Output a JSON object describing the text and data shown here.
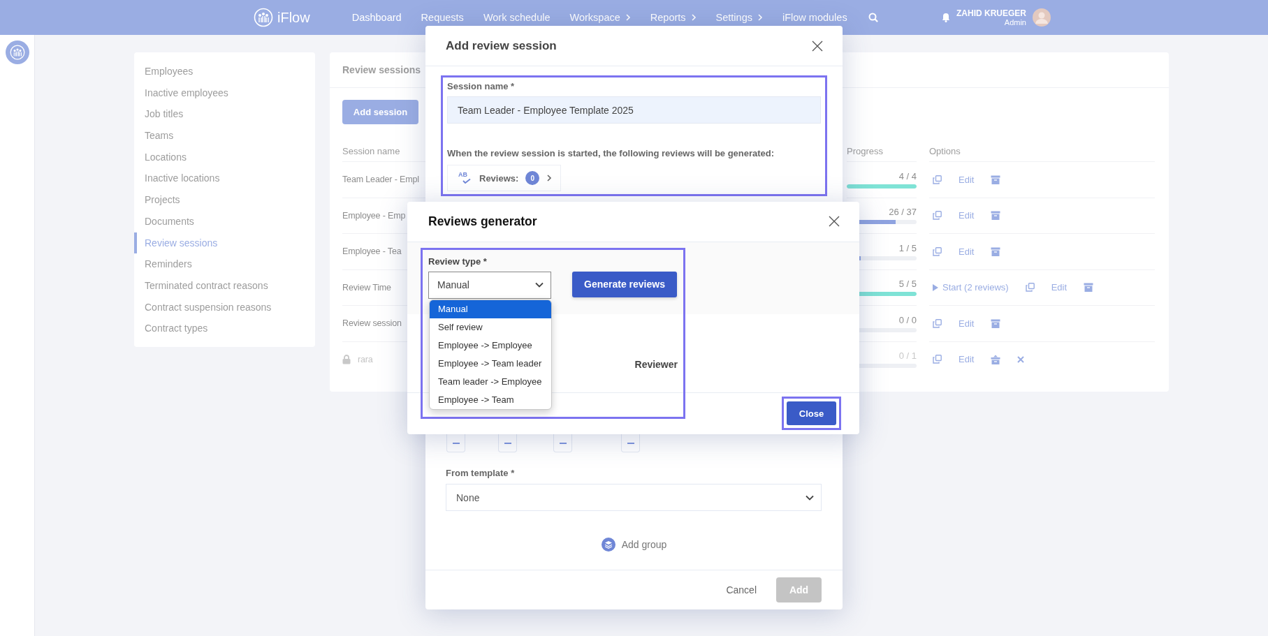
{
  "topbar": {
    "brand": "iFlow",
    "nav": [
      {
        "label": "Dashboard",
        "has_menu": false
      },
      {
        "label": "Requests",
        "has_menu": false
      },
      {
        "label": "Work schedule",
        "has_menu": false
      },
      {
        "label": "Workspace",
        "has_menu": true
      },
      {
        "label": "Reports",
        "has_menu": true
      },
      {
        "label": "Settings",
        "has_menu": true
      },
      {
        "label": "iFlow modules",
        "has_menu": false
      }
    ],
    "user": {
      "name": "ZAHID KRUEGER",
      "role": "Admin"
    }
  },
  "sidebar": {
    "items": [
      {
        "label": "Employees",
        "selected": false
      },
      {
        "label": "Inactive employees",
        "selected": false
      },
      {
        "label": "Job titles",
        "selected": false
      },
      {
        "label": "Teams",
        "selected": false
      },
      {
        "label": "Locations",
        "selected": false
      },
      {
        "label": "Inactive locations",
        "selected": false
      },
      {
        "label": "Projects",
        "selected": false
      },
      {
        "label": "Documents",
        "selected": false
      },
      {
        "label": "Review sessions",
        "selected": true
      },
      {
        "label": "Reminders",
        "selected": false
      },
      {
        "label": "Terminated contract reasons",
        "selected": false
      },
      {
        "label": "Contract suspension reasons",
        "selected": false
      },
      {
        "label": "Contract types",
        "selected": false
      }
    ]
  },
  "sessions_panel": {
    "title": "Review sessions",
    "add_button": "Add session",
    "columns": [
      "Session name",
      "Progress",
      "Options"
    ],
    "rows": [
      {
        "name": "Team Leader - Empl",
        "locked": false,
        "progress": "4 / 4",
        "level": 1,
        "edit": "Edit",
        "archived": false
      },
      {
        "name": "Employee - Emp",
        "locked": false,
        "progress": "26 / 37",
        "level": 0.7,
        "edit": "Edit",
        "archived": false
      },
      {
        "name": "Employee - Tea",
        "locked": false,
        "progress": "1 / 5",
        "level": 0.2,
        "edit": "Edit",
        "archived": false
      },
      {
        "name": "Review Time",
        "locked": false,
        "progress": "5 / 5",
        "level": 1,
        "start": "Start (2 reviews)",
        "edit": "Edit",
        "archived": false
      },
      {
        "name": "Review session",
        "locked": false,
        "progress": "0 / 0",
        "level": 0,
        "edit": "Edit",
        "archived": false
      },
      {
        "name": "rara",
        "locked": true,
        "progress": "0 / 1",
        "level": 0,
        "edit": "Edit",
        "archived": true
      }
    ]
  },
  "add_modal": {
    "title": "Add review session",
    "session_name": {
      "label": "Session name *",
      "value": "Team Leader - Employee Template 2025",
      "highlighted": true
    },
    "note": "When the review session is started, the following reviews will be generated:",
    "reviews_chip": {
      "icon_text": "AB",
      "label": "Reviews:",
      "count": "0"
    },
    "template": {
      "label": "From template *",
      "value": "None"
    },
    "add_group": "Add group",
    "cancel": "Cancel",
    "submit": {
      "label": "Add",
      "disabled": true
    }
  },
  "generator_modal": {
    "title": "Reviews generator",
    "review_type": {
      "label": "Review type *",
      "value": "Manual",
      "expanded": true,
      "highlighted": true,
      "options": [
        {
          "label": "Manual",
          "selected": true
        },
        {
          "label": "Self review",
          "selected": false
        },
        {
          "label": "Employee -> Employee",
          "selected": false
        },
        {
          "label": "Employee -> Team leader",
          "selected": false
        },
        {
          "label": "Team leader -> Employee",
          "selected": false
        },
        {
          "label": "Employee -> Team",
          "selected": false
        }
      ]
    },
    "generate_button": "Generate reviews",
    "column_header": "Reviewer",
    "close_button": {
      "label": "Close",
      "highlighted": true
    }
  }
}
